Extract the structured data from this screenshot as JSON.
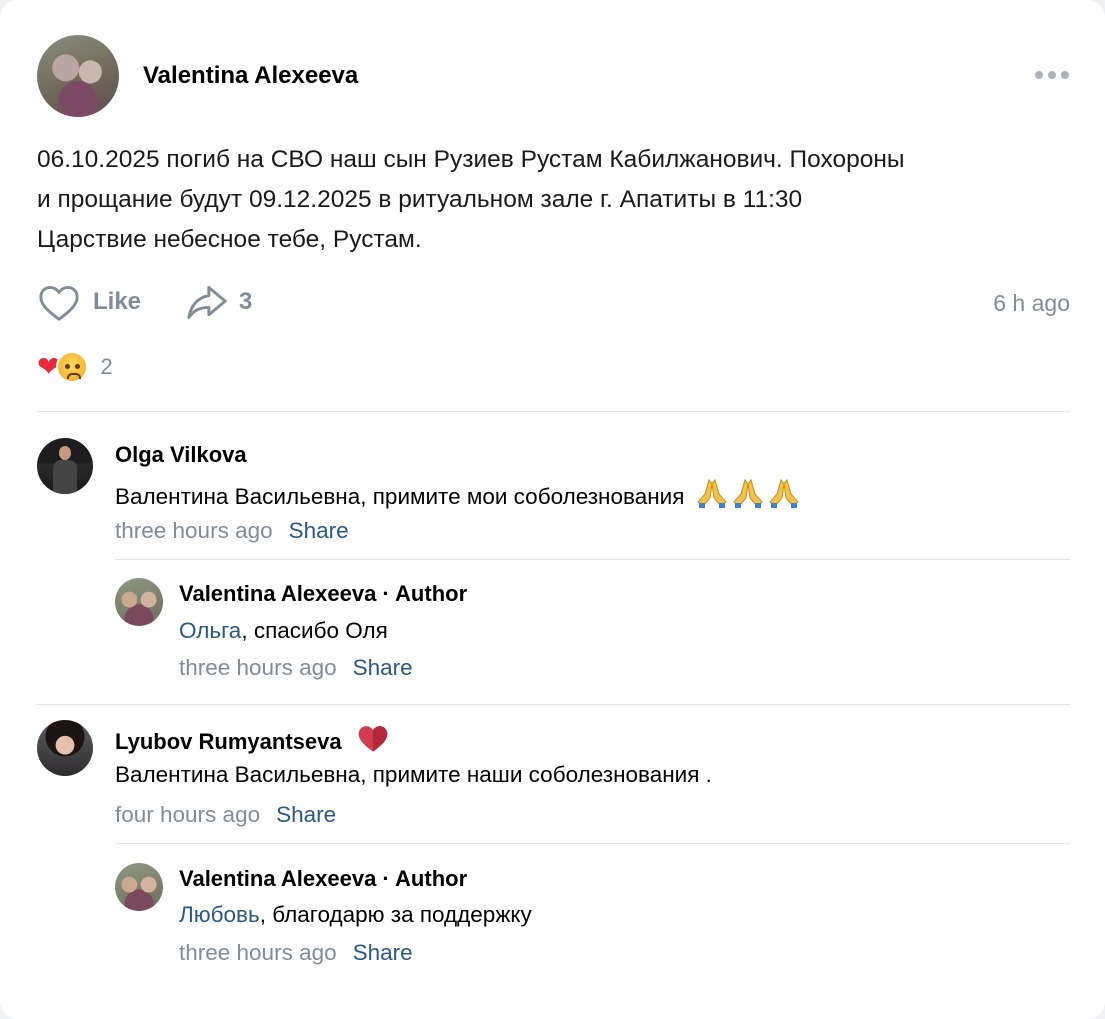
{
  "post": {
    "author": "Valentina Alexeeva",
    "text_lines": [
      "06.10.2025 погиб на СВО наш сын Рузиев Рустам Кабилжанович. Похороны",
      "и прощание будут 09.12.2025 в ритуальном зале г. Апатиты в 11:30",
      "Царствие небесное тебе, Рустам."
    ],
    "like_label": "Like",
    "share_count": "3",
    "time": "6 h ago",
    "reactions": {
      "icons": [
        "heart",
        "crying-face"
      ],
      "count": "2"
    }
  },
  "comments": [
    {
      "author": "Olga Vilkova",
      "text": "Валентина Васильевна, примите мои соболезнования",
      "emoji": "🙏🙏🙏",
      "time": "three hours ago",
      "share_label": "Share",
      "reply": {
        "author": "Valentina Alexeeva · Author",
        "mention": "Ольга",
        "text": ", спасибо Оля",
        "time": "three hours ago",
        "share_label": "Share"
      }
    },
    {
      "author": "Lyubov Rumyantseva",
      "badge": "heart",
      "text": "Валентина Васильевна, примите наши соболезнования .",
      "time": "four hours ago",
      "share_label": "Share",
      "reply": {
        "author": "Valentina Alexeeva · Author",
        "mention": "Любовь",
        "text": ", благодарю за поддержку",
        "time": "three hours ago",
        "share_label": "Share"
      }
    }
  ],
  "colors": {
    "link": "#2a5885",
    "muted": "#818c99",
    "divider": "#e2e5ea",
    "heart": "#e8283c"
  }
}
